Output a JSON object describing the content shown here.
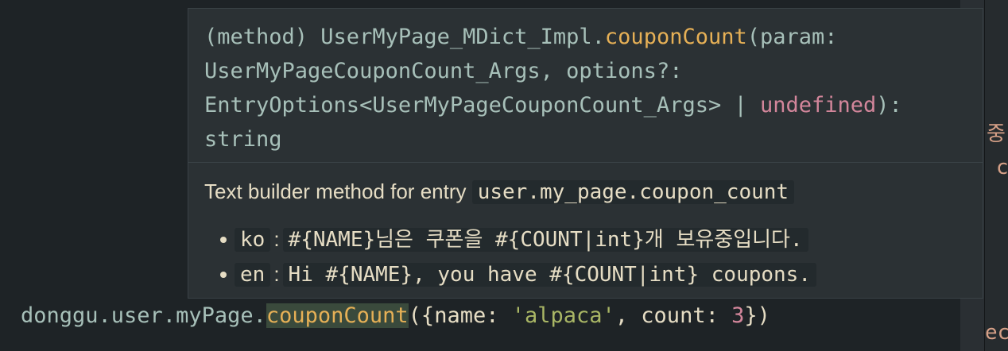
{
  "signature": {
    "prefix": "(method) UserMyPage_MDict_Impl.",
    "method": "couponCount",
    "params_line1": "(param:",
    "line2": "UserMyPageCouponCount_Args, options?:",
    "line3_type": "EntryOptions<UserMyPageCouponCount_Args> | ",
    "line3_undefined": "undefined",
    "line3_end": "):",
    "line4": "string"
  },
  "doc": {
    "description": "Text builder method for entry ",
    "entry_key": "user.my_page.coupon_count",
    "translations": [
      {
        "lang": "ko",
        "separator": ":",
        "text": "#{NAME}님은 쿠폰을 #{COUNT|int}개 보유중입니다."
      },
      {
        "lang": "en",
        "separator": ":",
        "text": "Hi #{NAME}, you have #{COUNT|int} coupons."
      }
    ]
  },
  "code": {
    "object_path": "donggu.user.myPage.",
    "method": "couponCount",
    "open": "({",
    "name_key": "name",
    "colon1": ": ",
    "name_value": "'alpaca'",
    "comma": ", ",
    "count_key": "count",
    "colon2": ": ",
    "count_value": "3",
    "close": "})"
  },
  "right_pane": {
    "fragment1": "중",
    "fragment2": "c",
    "fragment3": "ec"
  },
  "colors": {
    "background": "#1e2326",
    "hover_background": "#2b3134",
    "method_highlight": "#e6b056",
    "keyword": "#d3869b",
    "string": "#a9b665"
  }
}
